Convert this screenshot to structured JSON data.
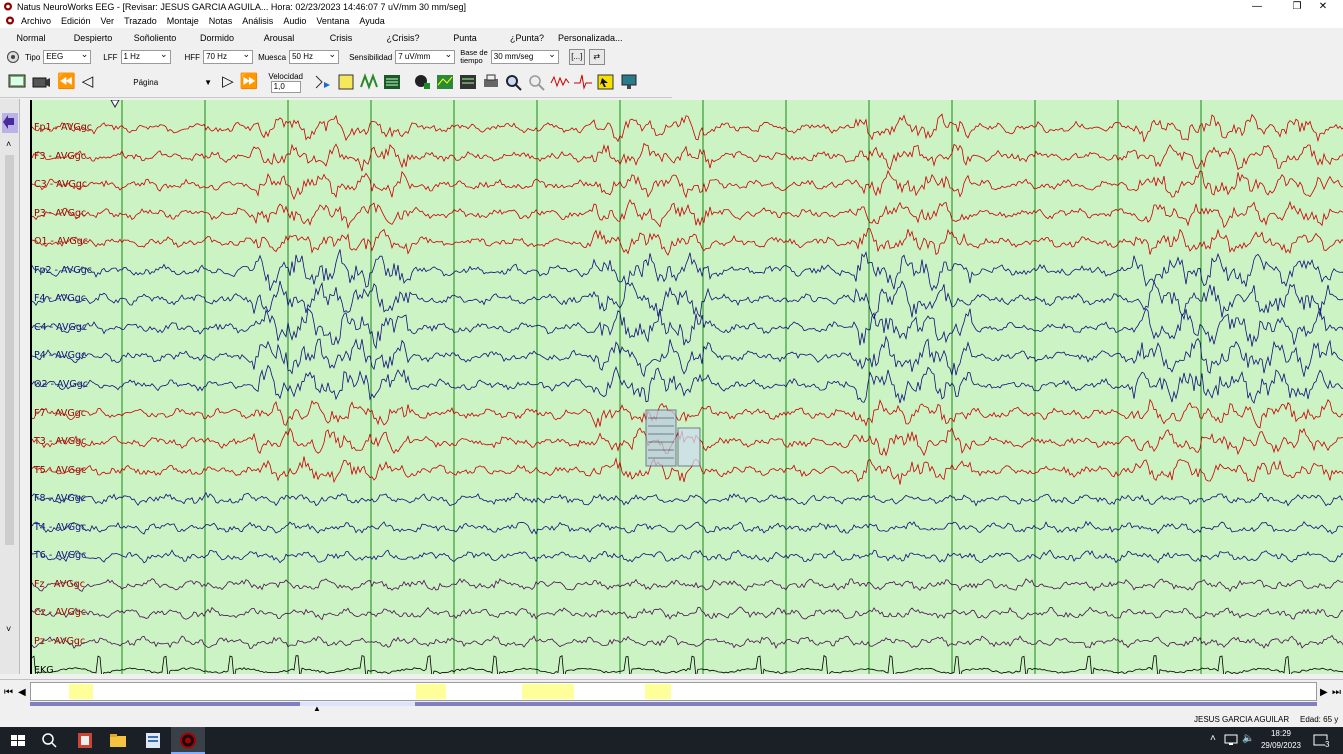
{
  "window": {
    "title": "Natus NeuroWorks EEG - [Revisar:  JESUS  GARCIA AGUILA...  Hora: 02/23/2023 14:46:07  7 uV/mm   30 mm/seg]",
    "controls": [
      "—",
      "❐",
      "✕"
    ]
  },
  "menu": [
    "Archivo",
    "Edición",
    "Ver",
    "Trazado",
    "Montaje",
    "Notas",
    "Análisis",
    "Audio",
    "Ventana",
    "Ayuda"
  ],
  "states": [
    "Normal",
    "Despierto",
    "Soñoliento",
    "Dormido",
    "Arousal",
    "Crisis",
    "¿Crisis?",
    "Punta",
    "¿Punta?",
    "Personalizada..."
  ],
  "filters": {
    "tipo_label": "Tipo",
    "tipo_value": "EEG",
    "lff_label": "LFF",
    "lff_value": "1 Hz",
    "hff_label": "HFF",
    "hff_value": "70 Hz",
    "muesca_label": "Muesca",
    "muesca_value": "50 Hz",
    "sens_label": "Sensibilidad",
    "sens_value": "7 uV/mm",
    "base_label_1": "Base de",
    "base_label_2": "tiempo",
    "base_value": "30 mm/seg",
    "btn_a": "[...]",
    "btn_b": "⇄"
  },
  "toolbar": {
    "page_label": "Página",
    "velocity_label": "Velocidad",
    "velocity_value": "1,0"
  },
  "channels": [
    {
      "label": "Fp1 - AVGgc",
      "color": "#c80000"
    },
    {
      "label": "F3 - AVGgc",
      "color": "#c80000"
    },
    {
      "label": "C3 - AVGgc",
      "color": "#c80000"
    },
    {
      "label": "P3 - AVGgc",
      "color": "#c80000"
    },
    {
      "label": "O1 - AVGgc",
      "color": "#c80000"
    },
    {
      "label": "Fp2 - AVGgc",
      "color": "#10107a"
    },
    {
      "label": "F4 - AVGgc",
      "color": "#10107a"
    },
    {
      "label": "C4 - AVGgc",
      "color": "#10107a"
    },
    {
      "label": "P4 - AVGgc",
      "color": "#10107a"
    },
    {
      "label": "O2 - AVGgc",
      "color": "#10107a"
    },
    {
      "label": "F7 - AVGgc",
      "color": "#c80000"
    },
    {
      "label": "T3 - AVGgc",
      "color": "#c80000"
    },
    {
      "label": "T5 - AVGgc",
      "color": "#c80000"
    },
    {
      "label": "F8 - AVGgc",
      "color": "#10107a"
    },
    {
      "label": "T4 - AVGgc",
      "color": "#10107a"
    },
    {
      "label": "T6 - AVGgc",
      "color": "#10107a"
    },
    {
      "label": "Fz - AVGgc",
      "color": "#4a1050"
    },
    {
      "label": "Cz - AVGgc",
      "color": "#4a1050"
    },
    {
      "label": "Pz - AVGgc",
      "color": "#4a1050"
    },
    {
      "label": "EKG",
      "color": "#000000"
    }
  ],
  "colors": {
    "background": "#ccf3c3",
    "gridline": "#1a8a1a",
    "timeline_highlight": "#ffff99"
  },
  "status": {
    "patient": "JESUS  GARCIA AGUILAR",
    "age": "Edad: 65 y"
  },
  "taskbar": {
    "time": "18:29",
    "date": "29/09/2023",
    "notif": "3"
  }
}
